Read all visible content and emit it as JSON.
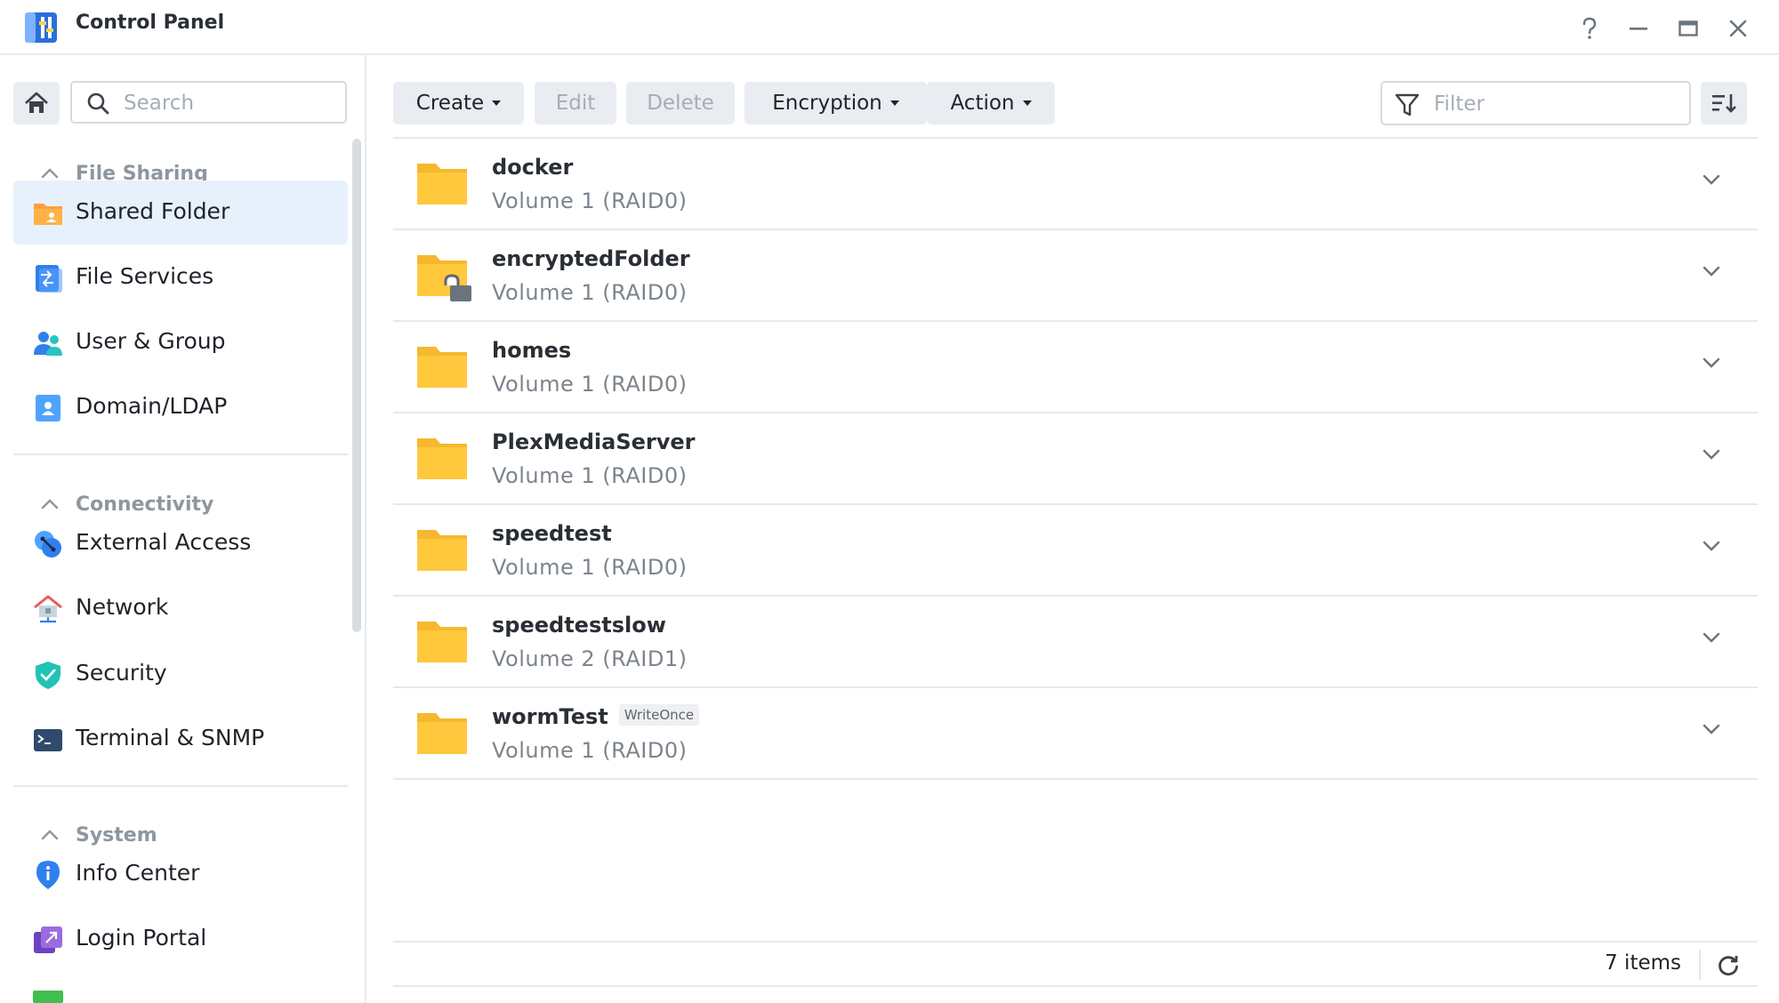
{
  "window": {
    "title": "Control Panel",
    "controls": [
      "help-icon",
      "minimize-icon",
      "maximize-icon",
      "close-icon"
    ]
  },
  "sidebar": {
    "search_placeholder": "Search",
    "sections": [
      {
        "title": "File Sharing",
        "items": [
          {
            "label": "Shared Folder",
            "icon": "shared-folder-icon",
            "active": true
          },
          {
            "label": "File Services",
            "icon": "file-services-icon"
          },
          {
            "label": "User & Group",
            "icon": "user-group-icon"
          },
          {
            "label": "Domain/LDAP",
            "icon": "domain-ldap-icon"
          }
        ]
      },
      {
        "title": "Connectivity",
        "items": [
          {
            "label": "External Access",
            "icon": "external-access-icon"
          },
          {
            "label": "Network",
            "icon": "network-icon"
          },
          {
            "label": "Security",
            "icon": "security-shield-icon"
          },
          {
            "label": "Terminal & SNMP",
            "icon": "terminal-icon"
          }
        ]
      },
      {
        "title": "System",
        "items": [
          {
            "label": "Info Center",
            "icon": "info-center-icon"
          },
          {
            "label": "Login Portal",
            "icon": "login-portal-icon"
          }
        ]
      }
    ]
  },
  "toolbar": {
    "create": "Create",
    "edit": "Edit",
    "delete": "Delete",
    "encryption": "Encryption",
    "action": "Action",
    "filter_placeholder": "Filter"
  },
  "folders": [
    {
      "name": "docker",
      "volume": "Volume 1 (RAID0)",
      "encrypted": false,
      "badge": ""
    },
    {
      "name": "encryptedFolder",
      "volume": "Volume 1 (RAID0)",
      "encrypted": true,
      "badge": ""
    },
    {
      "name": "homes",
      "volume": "Volume 1 (RAID0)",
      "encrypted": false,
      "badge": ""
    },
    {
      "name": "PlexMediaServer",
      "volume": "Volume 1 (RAID0)",
      "encrypted": false,
      "badge": ""
    },
    {
      "name": "speedtest",
      "volume": "Volume 1 (RAID0)",
      "encrypted": false,
      "badge": ""
    },
    {
      "name": "speedtestslow",
      "volume": "Volume 2 (RAID1)",
      "encrypted": false,
      "badge": ""
    },
    {
      "name": "wormTest",
      "volume": "Volume 1 (RAID0)",
      "encrypted": false,
      "badge": "WriteOnce"
    }
  ],
  "footer": {
    "item_count": "7 items"
  },
  "colors": {
    "folder": "#ffc83d",
    "folder_tab": "#f5b82e",
    "active_bg": "#e7f1fb",
    "button_bg": "#e9edf1",
    "accent_blue": "#2f80ed"
  }
}
